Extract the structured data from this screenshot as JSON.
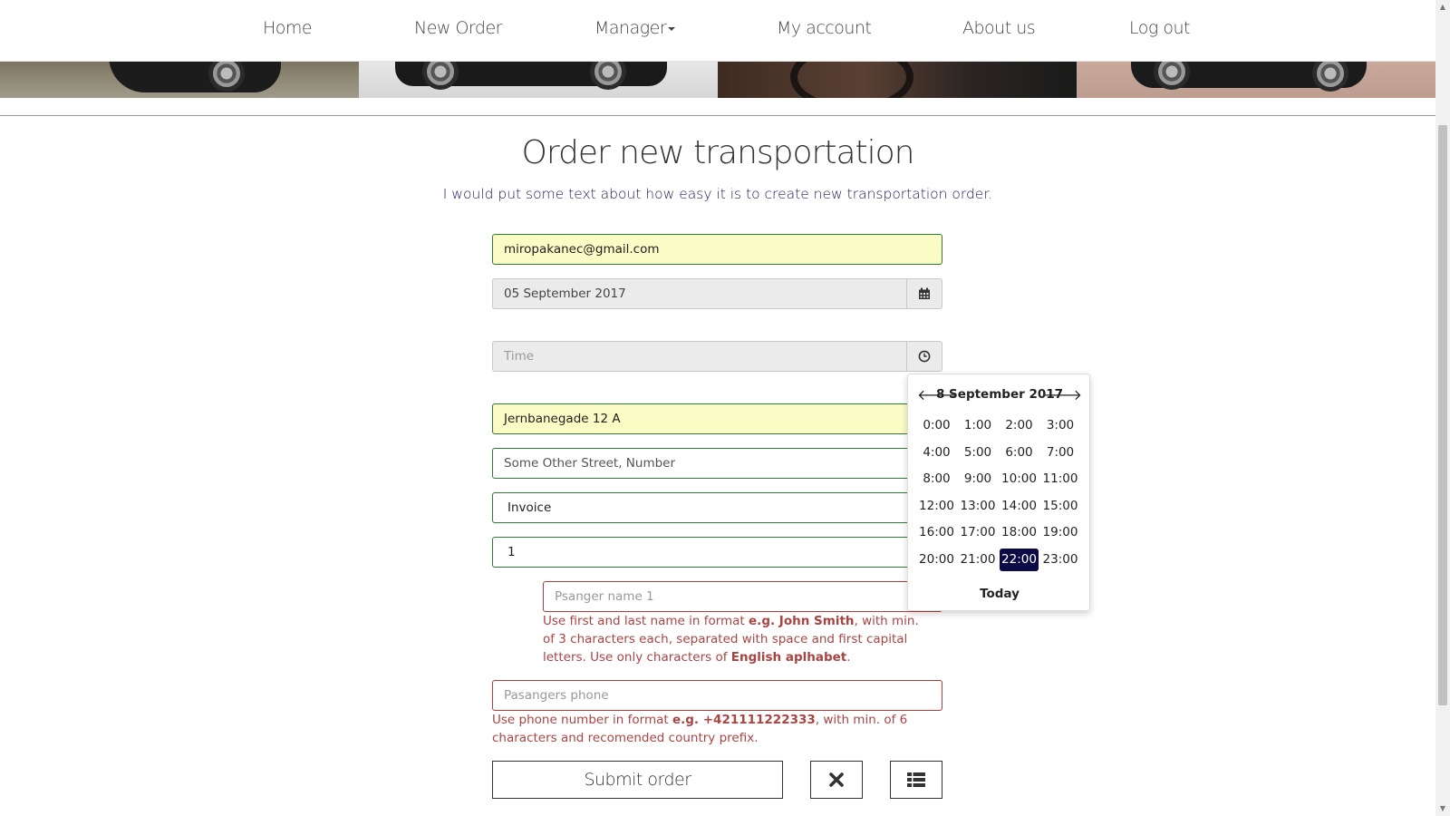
{
  "nav": {
    "items": [
      {
        "label": "Home"
      },
      {
        "label": "New Order"
      },
      {
        "label": "Manager"
      },
      {
        "label": "My account"
      },
      {
        "label": "About us"
      },
      {
        "label": "Log out"
      }
    ]
  },
  "page": {
    "title": "Order new transportation",
    "subtitle": "I would put some text about how easy it is to create new transportation order."
  },
  "form": {
    "email": "miropakanec@gmail.com",
    "date": "05 September 2017",
    "time_placeholder": "Time",
    "pickup_address": "Jernbanegade 12 A",
    "destination_placeholder": "Some Other Street, Number",
    "payment_method": "Invoice",
    "passenger_count": "1",
    "passenger_name_placeholder": "Psanger name 1",
    "passenger_name_error": {
      "t1": "Use first and last name in format ",
      "b1": "e.g. John Smith",
      "t2": ", with min. of 3 characters each, separated with space and first capital letters. Use only characters of ",
      "b2": "English aplhabet",
      "t3": "."
    },
    "phone_placeholder": "Pasangers phone",
    "phone_error": {
      "t1": "Use phone number in format ",
      "b1": "e.g. +421111222333",
      "t2": ", with min. of 6 characters and recomended country prefix."
    },
    "submit_label": "Submit order"
  },
  "picker": {
    "date": "8 September 2017",
    "hours": [
      "0:00",
      "1:00",
      "2:00",
      "3:00",
      "4:00",
      "5:00",
      "6:00",
      "7:00",
      "8:00",
      "9:00",
      "10:00",
      "11:00",
      "12:00",
      "13:00",
      "14:00",
      "15:00",
      "16:00",
      "17:00",
      "18:00",
      "19:00",
      "20:00",
      "21:00",
      "22:00",
      "23:00"
    ],
    "selected_hour": "22:00",
    "today_label": "Today"
  },
  "icons": {
    "calendar": "calendar-icon",
    "clock": "clock-icon",
    "clear": "close-icon",
    "list": "list-icon",
    "prev": "arrow-left-icon",
    "next": "arrow-right-icon",
    "caret": "caret-down-icon"
  },
  "colors": {
    "valid_border": "#2e7d32",
    "error": "#a94442",
    "autofill": "#fbfbc6",
    "picker_active": "#0b0b45"
  }
}
